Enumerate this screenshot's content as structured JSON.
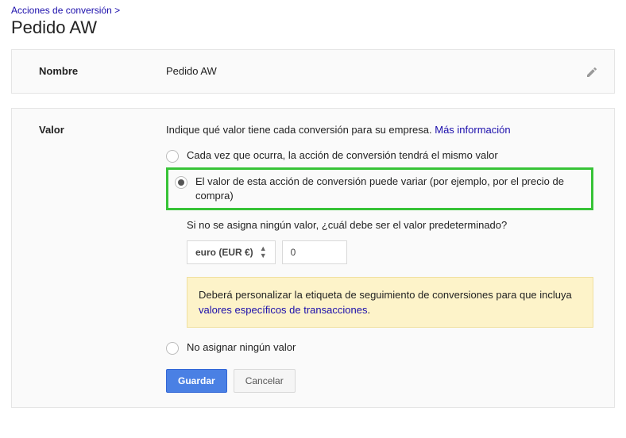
{
  "breadcrumb": {
    "link": "Acciones de conversión",
    "sep": ">"
  },
  "page_title": "Pedido AW",
  "name_panel": {
    "label": "Nombre",
    "value": "Pedido AW"
  },
  "value_panel": {
    "label": "Valor",
    "intro_text": "Indique qué valor tiene cada conversión para su empresa.",
    "intro_link": "Más información",
    "option_same": "Cada vez que ocurra, la acción de conversión tendrá el mismo valor",
    "option_vary": "El valor de esta acción de conversión puede variar (por ejemplo, por el precio de compra)",
    "default_prompt": "Si no se asigna ningún valor, ¿cuál debe ser el valor predeterminado?",
    "currency_label": "euro (EUR €)",
    "amount_value": "0",
    "alert_pre": "Deberá personalizar la etiqueta de seguimiento de conversiones para que incluya ",
    "alert_link": "valores específicos de transacciones",
    "alert_post": ".",
    "option_none": "No asignar ningún valor",
    "save": "Guardar",
    "cancel": "Cancelar"
  }
}
